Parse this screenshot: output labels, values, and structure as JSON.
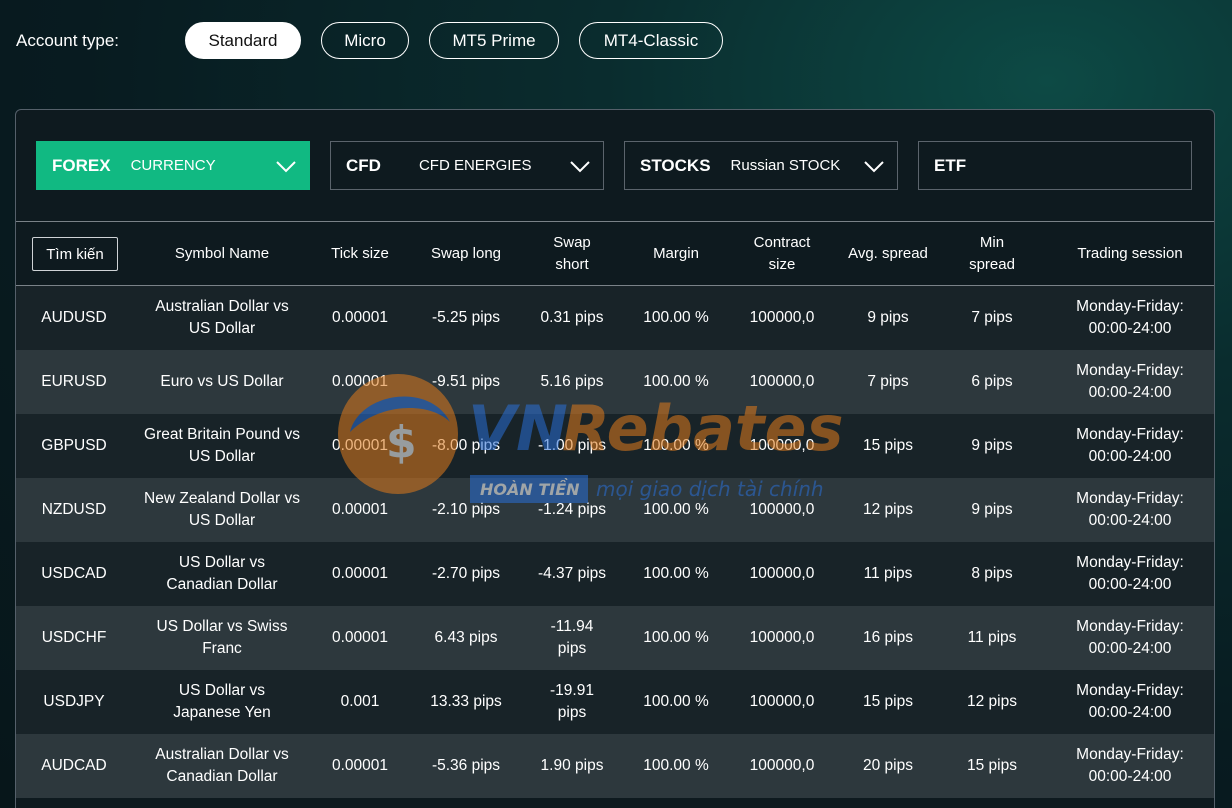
{
  "account": {
    "label": "Account type:",
    "types": [
      "Standard",
      "Micro",
      "MT5 Prime",
      "MT4-Classic"
    ],
    "selected": "Standard"
  },
  "categories": [
    {
      "main": "FOREX",
      "sub": "CURRENCY",
      "active": true
    },
    {
      "main": "CFD",
      "sub": "CFD ENERGIES",
      "active": false
    },
    {
      "main": "STOCKS",
      "sub": "Russian STOCK",
      "active": false
    },
    {
      "main": "ETF",
      "sub": "",
      "active": false
    }
  ],
  "table": {
    "search_label": "Tìm kiến",
    "headers": {
      "symbol_name": "Symbol Name",
      "tick_size": "Tick size",
      "swap_long": "Swap long",
      "swap_short": "Swap short",
      "margin": "Margin",
      "contract_size": "Contract size",
      "avg_spread": "Avg. spread",
      "min_spread": "Min spread",
      "trading_session": "Trading session"
    },
    "rows": [
      {
        "symbol": "AUDUSD",
        "name": "Australian Dollar vs US Dollar",
        "tick": "0.00001",
        "swap_long": "-5.25 pips",
        "swap_short": "0.31 pips",
        "margin": "100.00 %",
        "contract": "100000,0",
        "avg": "9 pips",
        "min": "7 pips",
        "session": "Monday-Friday: 00:00-24:00"
      },
      {
        "symbol": "EURUSD",
        "name": "Euro vs US Dollar",
        "tick": "0.00001",
        "swap_long": "-9.51 pips",
        "swap_short": "5.16 pips",
        "margin": "100.00 %",
        "contract": "100000,0",
        "avg": "7 pips",
        "min": "6 pips",
        "session": "Monday-Friday: 00:00-24:00"
      },
      {
        "symbol": "GBPUSD",
        "name": "Great Britain Pound vs US Dollar",
        "tick": "0.00001",
        "swap_long": "-8.00 pips",
        "swap_short": "-1.00 pips",
        "margin": "100.00 %",
        "contract": "100000,0",
        "avg": "15 pips",
        "min": "9 pips",
        "session": "Monday-Friday: 00:00-24:00"
      },
      {
        "symbol": "NZDUSD",
        "name": "New Zealand Dollar vs US Dollar",
        "tick": "0.00001",
        "swap_long": "-2.10 pips",
        "swap_short": "-1.24 pips",
        "margin": "100.00 %",
        "contract": "100000,0",
        "avg": "12 pips",
        "min": "9 pips",
        "session": "Monday-Friday: 00:00-24:00"
      },
      {
        "symbol": "USDCAD",
        "name": "US Dollar vs Canadian Dollar",
        "tick": "0.00001",
        "swap_long": "-2.70 pips",
        "swap_short": "-4.37 pips",
        "margin": "100.00 %",
        "contract": "100000,0",
        "avg": "11 pips",
        "min": "8 pips",
        "session": "Monday-Friday: 00:00-24:00"
      },
      {
        "symbol": "USDCHF",
        "name": "US Dollar vs Swiss Franc",
        "tick": "0.00001",
        "swap_long": "6.43 pips",
        "swap_short": "-11.94 pips",
        "margin": "100.00 %",
        "contract": "100000,0",
        "avg": "16 pips",
        "min": "11 pips",
        "session": "Monday-Friday: 00:00-24:00"
      },
      {
        "symbol": "USDJPY",
        "name": "US Dollar vs Japanese Yen",
        "tick": "0.001",
        "swap_long": "13.33 pips",
        "swap_short": "-19.91 pips",
        "margin": "100.00 %",
        "contract": "100000,0",
        "avg": "15 pips",
        "min": "12 pips",
        "session": "Monday-Friday: 00:00-24:00"
      },
      {
        "symbol": "AUDCAD",
        "name": "Australian Dollar vs Canadian Dollar",
        "tick": "0.00001",
        "swap_long": "-5.36 pips",
        "swap_short": "1.90 pips",
        "margin": "100.00 %",
        "contract": "100000,0",
        "avg": "20 pips",
        "min": "15 pips",
        "session": "Monday-Friday: 00:00-24:00"
      }
    ]
  },
  "watermark": {
    "brand": "VNRebates",
    "badge": "HOÀN TIỀN",
    "tagline": "mọi giao dịch tài chính"
  },
  "colors": {
    "accent": "#11b982",
    "row_dark": "#182328",
    "row_light": "#2d383d"
  }
}
